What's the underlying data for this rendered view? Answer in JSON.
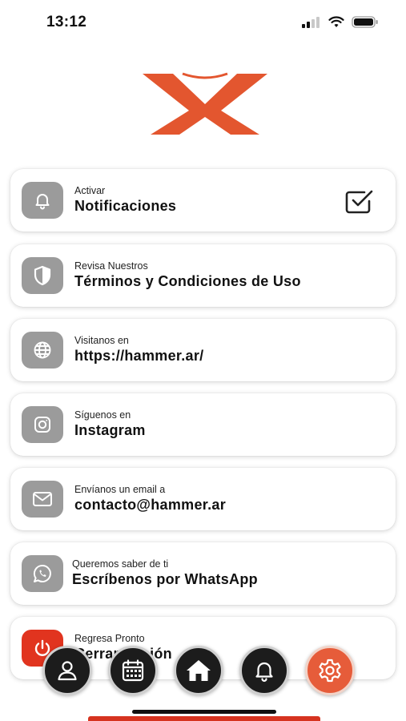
{
  "status_bar": {
    "time": "13:12"
  },
  "items": [
    {
      "subtitle": "Activar",
      "title": "Notificaciones",
      "icon": "bell-icon"
    },
    {
      "subtitle": "Revisa Nuestros",
      "title": "Términos y Condiciones de Uso",
      "icon": "shield-icon"
    },
    {
      "subtitle": "Visitanos en",
      "title": "https://hammer.ar/",
      "icon": "globe-icon"
    },
    {
      "subtitle": "Síguenos en",
      "title": "Instagram",
      "icon": "instagram-icon"
    },
    {
      "subtitle": "Envíanos un email a",
      "title": "contacto@hammer.ar",
      "icon": "mail-icon"
    },
    {
      "subtitle": "Queremos saber de ti",
      "title": "Escríbenos por WhatsApp",
      "icon": "whatsapp-icon"
    },
    {
      "subtitle": "Regresa Pronto",
      "title": "Cerrar Sesión",
      "icon": "power-icon"
    }
  ],
  "notifications_checked": true,
  "bottom_nav": [
    {
      "icon": "user-icon",
      "active": false
    },
    {
      "icon": "calendar-icon",
      "active": false
    },
    {
      "icon": "home-icon",
      "active": false
    },
    {
      "icon": "bell-icon",
      "active": false
    },
    {
      "icon": "gear-icon",
      "active": true
    }
  ],
  "colors": {
    "accent": "#e65c3a",
    "logo": "#e3562f",
    "icon_bg": "#9b9b9b",
    "logout": "#e1341f",
    "nav_bg": "#1c1c1c"
  }
}
